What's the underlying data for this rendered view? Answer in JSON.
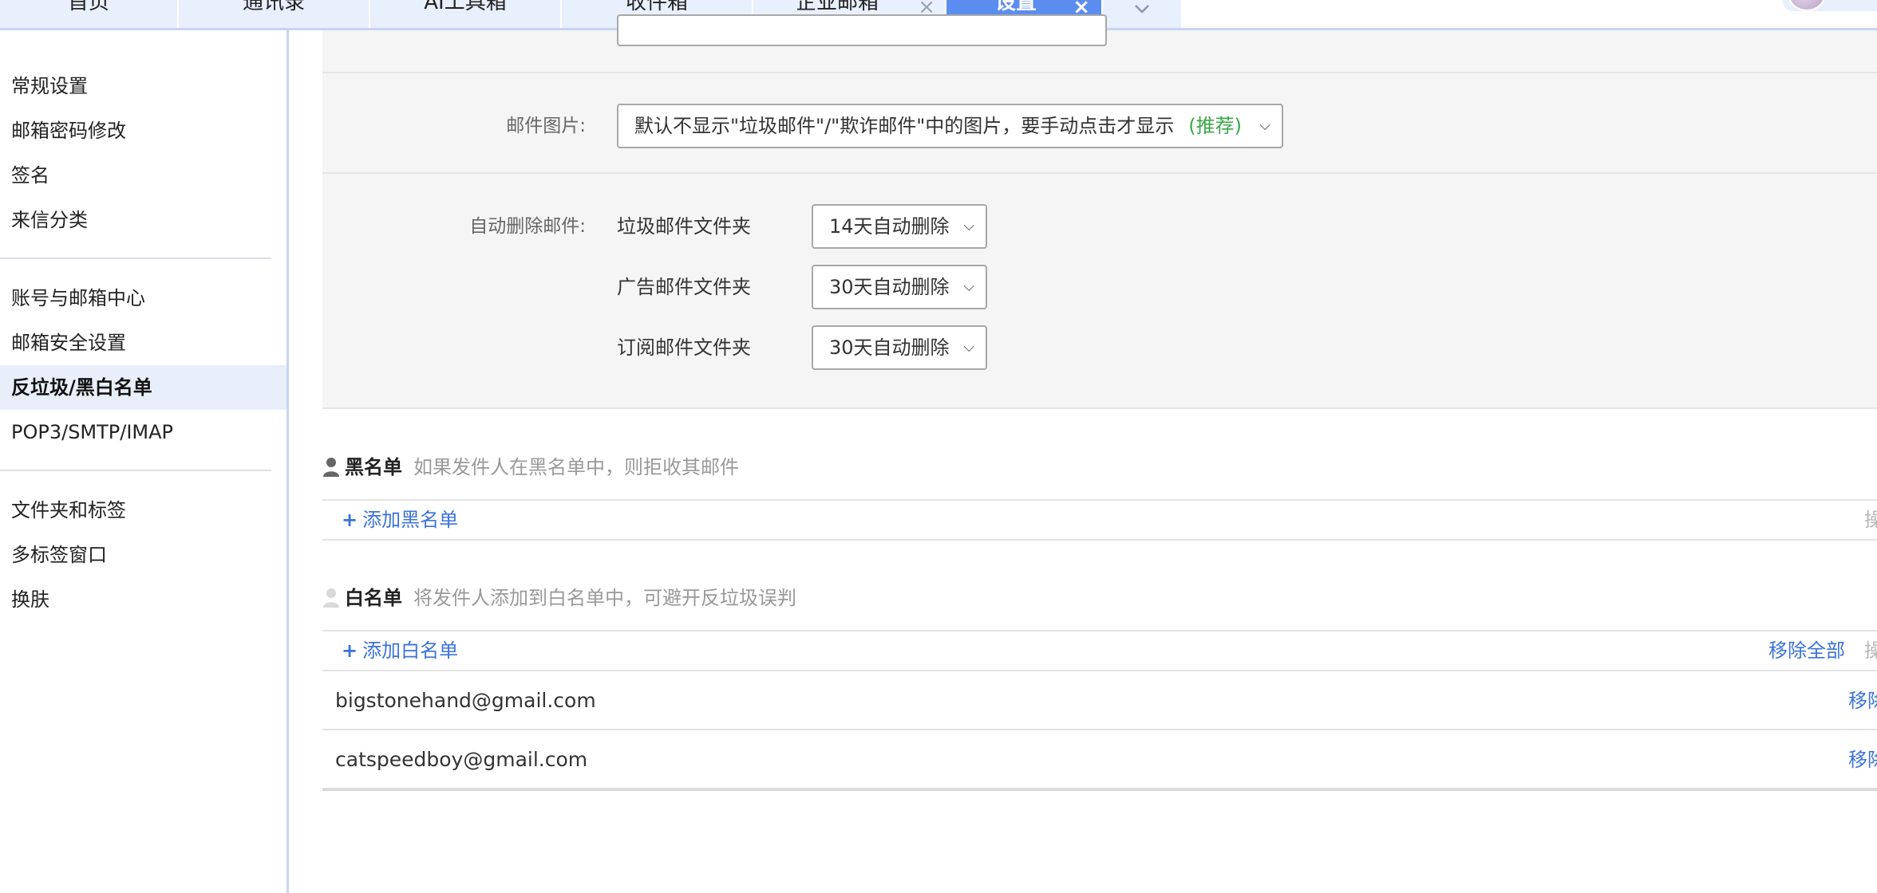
{
  "tabs": [
    {
      "label": "首页"
    },
    {
      "label": "通讯录"
    },
    {
      "label": "AI工具箱"
    },
    {
      "label": "收件箱"
    },
    {
      "label": "企业邮箱",
      "close": "×"
    },
    {
      "label": "设置",
      "close": "×",
      "active": true
    }
  ],
  "tab_more_icon": "chevron-down",
  "sidebar": {
    "items": [
      {
        "label": "常规设置"
      },
      {
        "label": "邮箱密码修改"
      },
      {
        "label": "签名"
      },
      {
        "label": "来信分类"
      },
      {
        "label": "账号与邮箱中心"
      },
      {
        "label": "邮箱安全设置"
      },
      {
        "label": "反垃圾/黑白名单",
        "active": true
      },
      {
        "label": "POP3/SMTP/IMAP"
      },
      {
        "label": "文件夹和标签"
      },
      {
        "label": "多标签窗口"
      },
      {
        "label": "换肤"
      }
    ]
  },
  "settings": {
    "mail_images": {
      "label": "邮件图片:",
      "value": "默认不显示\"垃圾邮件\"/\"欺诈邮件\"中的图片，要手动点击才显示",
      "recommend": "(推荐)"
    },
    "auto_delete": {
      "label": "自动删除邮件:",
      "rows": [
        {
          "folder": "垃圾邮件文件夹",
          "value": "14天自动删除"
        },
        {
          "folder": "广告邮件文件夹",
          "value": "30天自动删除"
        },
        {
          "folder": "订阅邮件文件夹",
          "value": "30天自动删除"
        }
      ]
    }
  },
  "blacklist": {
    "title": "黑名单",
    "desc": "如果发件人在黑名单中，则拒收其邮件",
    "add": "添加黑名单",
    "op": "操"
  },
  "whitelist": {
    "title": "白名单",
    "desc": "将发件人添加到白名单中，可避开反垃圾误判",
    "add": "添加白名单",
    "remove_all": "移除全部",
    "op": "操",
    "entries": [
      {
        "email": "bigstonehand@gmail.com",
        "action": "移除"
      },
      {
        "email": "catspeedboy@gmail.com",
        "action": "移除"
      }
    ]
  },
  "colors": {
    "accent": "#5b8df0",
    "link": "#3b73d8",
    "recommend": "#39a845"
  }
}
